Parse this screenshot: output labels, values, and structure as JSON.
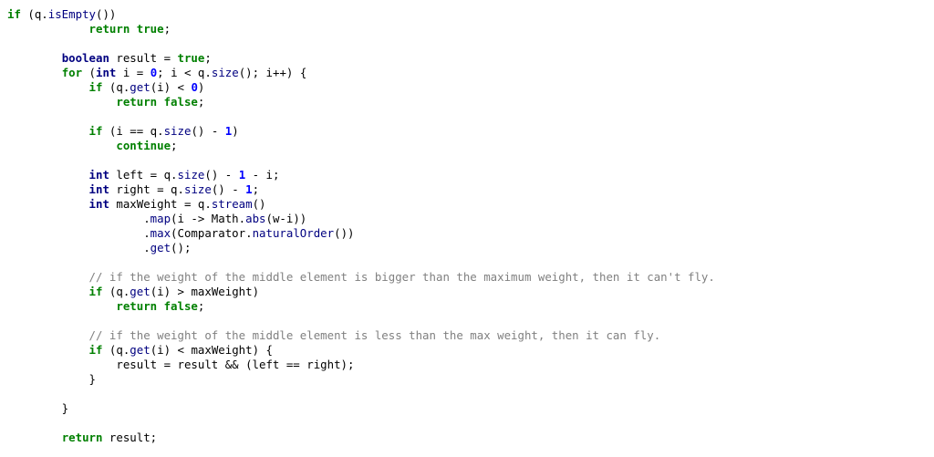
{
  "editor": {
    "lines": [
      [
        [
          "if",
          "k"
        ],
        [
          " (q.",
          "p"
        ],
        [
          "isEmpty",
          "m"
        ],
        [
          "())",
          "p"
        ]
      ],
      [
        [
          "            ",
          "p"
        ],
        [
          "return",
          "k"
        ],
        [
          " ",
          "p"
        ],
        [
          "true",
          "k"
        ],
        [
          ";",
          "p"
        ]
      ],
      [],
      [
        [
          "        ",
          "p"
        ],
        [
          "boolean",
          "t"
        ],
        [
          " result = ",
          "p"
        ],
        [
          "true",
          "k"
        ],
        [
          ";",
          "p"
        ]
      ],
      [
        [
          "        ",
          "p"
        ],
        [
          "for",
          "k"
        ],
        [
          " (",
          "p"
        ],
        [
          "int",
          "t"
        ],
        [
          " i = ",
          "p"
        ],
        [
          "0",
          "n"
        ],
        [
          "; i < q.",
          "p"
        ],
        [
          "size",
          "m"
        ],
        [
          "(); i++) {",
          "p"
        ]
      ],
      [
        [
          "            ",
          "p"
        ],
        [
          "if",
          "k"
        ],
        [
          " (q.",
          "p"
        ],
        [
          "get",
          "m"
        ],
        [
          "(i) < ",
          "p"
        ],
        [
          "0",
          "n"
        ],
        [
          ")",
          "p"
        ]
      ],
      [
        [
          "                ",
          "p"
        ],
        [
          "return",
          "k"
        ],
        [
          " ",
          "p"
        ],
        [
          "false",
          "k"
        ],
        [
          ";",
          "p"
        ]
      ],
      [],
      [
        [
          "            ",
          "p"
        ],
        [
          "if",
          "k"
        ],
        [
          " (i == q.",
          "p"
        ],
        [
          "size",
          "m"
        ],
        [
          "() - ",
          "p"
        ],
        [
          "1",
          "n"
        ],
        [
          ")",
          "p"
        ]
      ],
      [
        [
          "                ",
          "p"
        ],
        [
          "continue",
          "k"
        ],
        [
          ";",
          "p"
        ]
      ],
      [],
      [
        [
          "            ",
          "p"
        ],
        [
          "int",
          "t"
        ],
        [
          " left = q.",
          "p"
        ],
        [
          "size",
          "m"
        ],
        [
          "() - ",
          "p"
        ],
        [
          "1",
          "n"
        ],
        [
          " - i;",
          "p"
        ]
      ],
      [
        [
          "            ",
          "p"
        ],
        [
          "int",
          "t"
        ],
        [
          " right = q.",
          "p"
        ],
        [
          "size",
          "m"
        ],
        [
          "() - ",
          "p"
        ],
        [
          "1",
          "n"
        ],
        [
          ";",
          "p"
        ]
      ],
      [
        [
          "            ",
          "p"
        ],
        [
          "int",
          "t"
        ],
        [
          " maxWeight = q.",
          "p"
        ],
        [
          "stream",
          "m"
        ],
        [
          "()",
          "p"
        ]
      ],
      [
        [
          "                    .",
          "p"
        ],
        [
          "map",
          "m"
        ],
        [
          "(i -> Math.",
          "p"
        ],
        [
          "abs",
          "m"
        ],
        [
          "(w-i))",
          "p"
        ]
      ],
      [
        [
          "                    .",
          "p"
        ],
        [
          "max",
          "m"
        ],
        [
          "(Comparator.",
          "p"
        ],
        [
          "naturalOrder",
          "m"
        ],
        [
          "())",
          "p"
        ]
      ],
      [
        [
          "                    .",
          "p"
        ],
        [
          "get",
          "m"
        ],
        [
          "();",
          "p"
        ]
      ],
      [],
      [
        [
          "            ",
          "p"
        ],
        [
          "// if the weight of the middle element is bigger than the maximum weight, then it can't fly.",
          "c"
        ]
      ],
      [
        [
          "            ",
          "p"
        ],
        [
          "if",
          "k"
        ],
        [
          " (q.",
          "p"
        ],
        [
          "get",
          "m"
        ],
        [
          "(i) > maxWeight)",
          "p"
        ]
      ],
      [
        [
          "                ",
          "p"
        ],
        [
          "return",
          "k"
        ],
        [
          " ",
          "p"
        ],
        [
          "false",
          "k"
        ],
        [
          ";",
          "p"
        ]
      ],
      [],
      [
        [
          "            ",
          "p"
        ],
        [
          "// if the weight of the middle element is less than the max weight, then it can fly.",
          "c"
        ]
      ],
      [
        [
          "            ",
          "p"
        ],
        [
          "if",
          "k"
        ],
        [
          " (q.",
          "p"
        ],
        [
          "get",
          "m"
        ],
        [
          "(i) < maxWeight) {",
          "p"
        ]
      ],
      [
        [
          "                result = result && (left == right);",
          "p"
        ]
      ],
      [
        [
          "            }",
          "p"
        ]
      ],
      [],
      [
        [
          "        }",
          "p"
        ]
      ],
      [],
      [
        [
          "        ",
          "p"
        ],
        [
          "return",
          "k"
        ],
        [
          " result;",
          "p"
        ]
      ]
    ]
  }
}
